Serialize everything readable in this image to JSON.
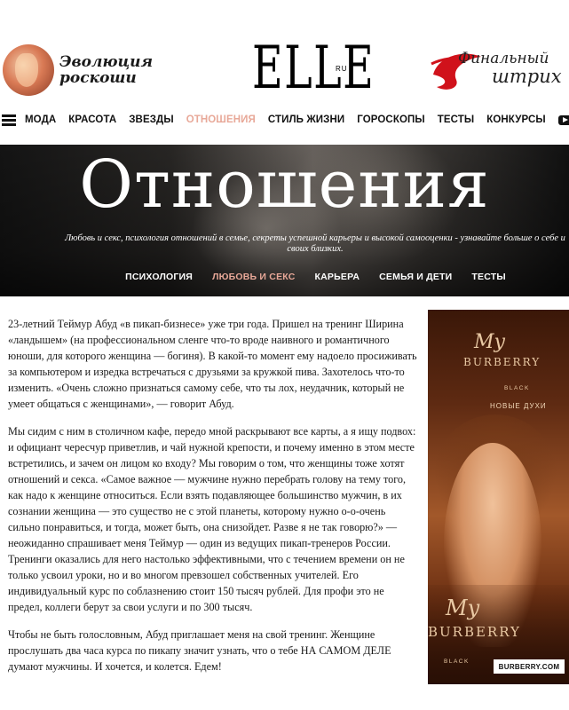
{
  "header": {
    "promo_left": {
      "line1": "Эволюция",
      "line2": "роскоши"
    },
    "logo": {
      "word": "ELLE",
      "suffix": "RU"
    },
    "promo_right": {
      "line1": "Финальный",
      "line2": "штрих"
    }
  },
  "nav": {
    "items": [
      {
        "label": "МОДА",
        "active": false
      },
      {
        "label": "КРАСОТА",
        "active": false
      },
      {
        "label": "ЗВЕЗДЫ",
        "active": false
      },
      {
        "label": "ОТНОШЕНИЯ",
        "active": true
      },
      {
        "label": "СТИЛЬ ЖИЗНИ",
        "active": false
      },
      {
        "label": "ГОРОСКОПЫ",
        "active": false
      },
      {
        "label": "ТЕСТЫ",
        "active": false
      },
      {
        "label": "КОНКУРСЫ",
        "active": false
      }
    ],
    "video_label": "В"
  },
  "hero": {
    "title": "Отношения",
    "subtitle": "Любовь и секс, психология отношений в семье, секреты успешной карьеры и высокой самооценки - узнавайте больше о себе и своих близких.",
    "subnav": [
      {
        "label": "ПСИХОЛОГИЯ",
        "active": false
      },
      {
        "label": "ЛЮБОВЬ И СЕКС",
        "active": true
      },
      {
        "label": "КАРЬЕРА",
        "active": false
      },
      {
        "label": "СЕМЬЯ И ДЕТИ",
        "active": false
      },
      {
        "label": "ТЕСТЫ",
        "active": false
      }
    ]
  },
  "article": {
    "paragraphs": [
      "23-летний Теймур Абуд «в пикап-бизнесе» уже три года. Пришел на тренинг Ширина «ландышем» (на профессиональном сленге что-то вроде наивного и романтичного юноши, для которого женщина — богиня). В какой-то момент ему надоело просиживать за компьютером и изредка встречаться с друзьями за кружкой пива. Захотелось что-то изменить. «Очень сложно признаться самому себе, что ты лох, неудачник, который не умеет общаться с женщинами», — говорит Абуд.",
      "Мы сидим с ним в столичном кафе, передо мной раскрывают все карты, а я ищу подвох: и официант чересчур приветлив, и чай нужной крепости, и почему именно в этом месте встретились, и зачем он лицом ко входу? Мы говорим о том, что женщины тоже хотят отношений и секса. «Самое важное — мужчине нужно перебрать голову на тему того, как надо к женщине относиться. Если взять подавляющее большинство мужчин, в их сознании женщина — это существо не с этой планеты, которому нужно о-о-очень сильно понравиться, и тогда, может быть, она снизойдет. Разве я не так говорю?» — неожиданно спрашивает меня Теймур — один из ведущих пикап-тренеров России. Тренинги оказались для него настолько эффективными, что с течением времени он не только усвоил уроки, но и во многом превзошел собственных учителей. Его индивидуальный курс по соблазнению стоит 150 тысяч рублей. Для профи это не предел, коллеги берут за свои услуги и по 300 тысяч.",
      "Чтобы не быть голословным, Абуд приглашает меня на свой тренинг. Женщине прослушать два часа курса по пикапу значит узнать, что о тебе НА САМОМ ДЕЛЕ думают мужчины. И хочется, и колется. Едем!"
    ]
  },
  "ad": {
    "my": "My",
    "brand": "BURBERRY",
    "black": "BLACK",
    "tagline": "НОВЫЕ ДУХИ",
    "my_bottle": "My",
    "brand_bottle": "BURBERRY",
    "black_bottle": "BLACK",
    "url": "BURBERRY.COM"
  },
  "colors": {
    "accent": "#e8a898",
    "promo_red": "#d0121b"
  }
}
